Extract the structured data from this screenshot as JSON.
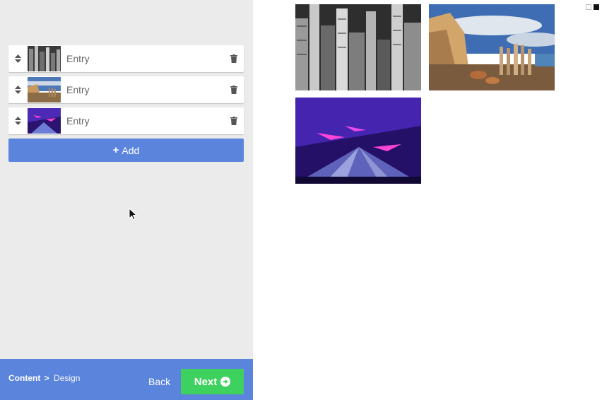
{
  "editor": {
    "entries": [
      {
        "label": "Entry",
        "thumbnail": "city-skyline-bw"
      },
      {
        "label": "Entry",
        "thumbnail": "beach-cliff-pilings"
      },
      {
        "label": "Entry",
        "thumbnail": "purple-laser-show"
      }
    ],
    "add_label": "Add"
  },
  "bottom_bar": {
    "crumb_active": "Content",
    "crumb_separator": ">",
    "crumb_next": "Design",
    "back_label": "Back",
    "next_label": "Next"
  },
  "colors": {
    "panel_bg": "#ebebeb",
    "accent_blue": "#5b85dc",
    "next_green": "#3fd15f"
  },
  "icons": [
    "sort-arrows-icon",
    "trash-icon",
    "plus-icon",
    "arrow-circle-right-icon"
  ]
}
